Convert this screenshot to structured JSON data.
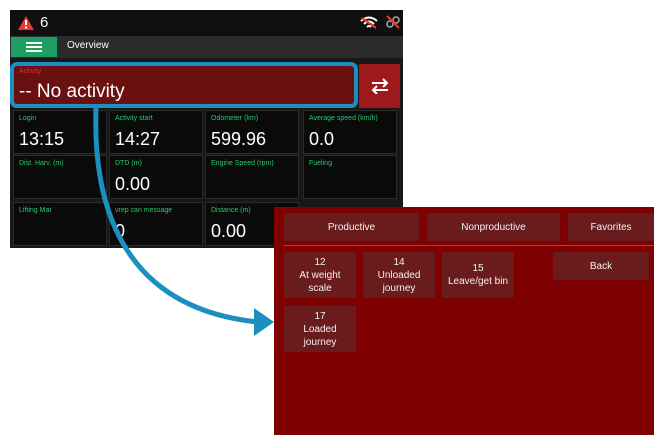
{
  "status_bar": {
    "warning_count": "6",
    "icons": [
      "warning-icon",
      "wifi-off-icon",
      "gps-off-icon"
    ]
  },
  "nav": {
    "menu_icon": "hamburger-menu-icon",
    "title": "Overview"
  },
  "activity": {
    "label": "Activity",
    "value": "-- No activity",
    "switch_icon": "swap-arrows-icon"
  },
  "tiles": [
    {
      "label": "Login",
      "value": "13:15"
    },
    {
      "label": "Activity start",
      "value": "14:27"
    },
    {
      "label": "Odometer (km)",
      "value": "599.96"
    },
    {
      "label": "Average speed (km/h)",
      "value": "0.0"
    },
    {
      "label": "Dist. Harv. (m)",
      "value": ""
    },
    {
      "label": "DTD (m)",
      "value": "0.00"
    },
    {
      "label": "Engine Speed (rpm)",
      "value": ""
    },
    {
      "label": "Fueling",
      "value": ""
    },
    {
      "label": "Lifting Mat",
      "value": ""
    },
    {
      "label": "vrep can message",
      "value": "0"
    },
    {
      "label": "Distance (m)",
      "value": "0.00"
    }
  ],
  "popup": {
    "tabs": [
      "Productive",
      "Nonproductive",
      "Favorites"
    ],
    "back_label": "Back",
    "activities": [
      {
        "code": "12",
        "name": "At weight\nscale"
      },
      {
        "code": "14",
        "name": "Unloaded\njourney"
      },
      {
        "code": "15",
        "name": "Leave/get bin"
      },
      {
        "code": "17",
        "name": "Loaded\njourney"
      }
    ]
  },
  "colors": {
    "accent_green": "#1e9e63",
    "label_green": "#27c96d",
    "activity_red": "#6a1010",
    "popup_red": "#7f0000",
    "callout_blue": "#1a8fc0",
    "warning_red": "#e53935"
  }
}
